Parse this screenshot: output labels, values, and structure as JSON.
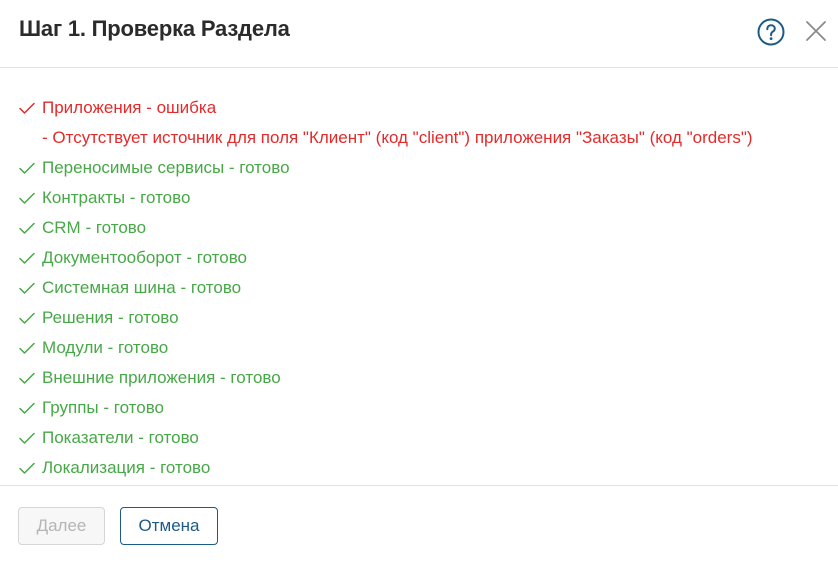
{
  "dialog": {
    "title": "Шаг 1. Проверка Раздела",
    "help_icon": "question-circle-icon",
    "close_icon": "close-x-icon"
  },
  "colors": {
    "error": "#e32b2b",
    "success": "#47a847",
    "accent": "#1d5b87",
    "title": "#2b2b2b"
  },
  "checks": [
    {
      "text": "Приложения - ошибка",
      "status": "error",
      "icon": "check-icon"
    },
    {
      "text": "- Отсутствует источник для поля \"Клиент\" (код \"client\") приложения \"Заказы\" (код \"orders\")",
      "status": "error-detail",
      "icon": ""
    },
    {
      "text": "Переносимые сервисы - готово",
      "status": "ok",
      "icon": "check-icon"
    },
    {
      "text": "Контракты - готово",
      "status": "ok",
      "icon": "check-icon"
    },
    {
      "text": "CRM - готово",
      "status": "ok",
      "icon": "check-icon"
    },
    {
      "text": "Документооборот - готово",
      "status": "ok",
      "icon": "check-icon"
    },
    {
      "text": "Системная шина - готово",
      "status": "ok",
      "icon": "check-icon"
    },
    {
      "text": "Решения - готово",
      "status": "ok",
      "icon": "check-icon"
    },
    {
      "text": "Модули - готово",
      "status": "ok",
      "icon": "check-icon"
    },
    {
      "text": "Внешние приложения - готово",
      "status": "ok",
      "icon": "check-icon"
    },
    {
      "text": "Группы - готово",
      "status": "ok",
      "icon": "check-icon"
    },
    {
      "text": "Показатели - готово",
      "status": "ok",
      "icon": "check-icon"
    },
    {
      "text": "Локализация - готово",
      "status": "ok",
      "icon": "check-icon"
    }
  ],
  "footer": {
    "next_label": "Далее",
    "next_disabled": true,
    "cancel_label": "Отмена"
  }
}
